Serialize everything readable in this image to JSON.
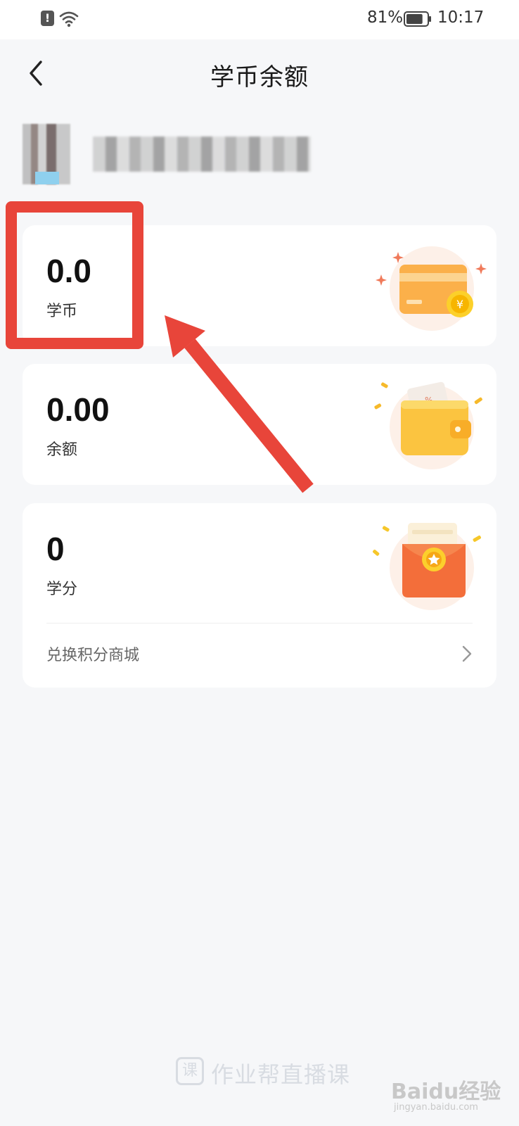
{
  "status_bar": {
    "alert_glyph": "!",
    "wifi_icon": "wifi-icon",
    "battery_percent": "81%",
    "battery_level": 0.81,
    "time": "10:17"
  },
  "header": {
    "back_icon": "chevron-left-icon",
    "title": "学币余额"
  },
  "cards": {
    "coins": {
      "value": "0.0",
      "label": "学币",
      "icon": "bank-card-coin-icon"
    },
    "balance": {
      "value": "0.00",
      "label": "余额",
      "icon": "wallet-icon"
    },
    "points": {
      "value": "0",
      "label": "学分",
      "icon": "red-envelope-icon"
    }
  },
  "mall_link": {
    "label": "兑换积分商城",
    "icon": "chevron-right-icon"
  },
  "footer": {
    "logo_glyph": "课",
    "brand": "作业帮直播课"
  },
  "watermark": {
    "main": "Baidu经验",
    "sub": "jingyan.baidu.com"
  },
  "colors": {
    "annotation_red": "#e8453a",
    "page_background": "#f6f7f9",
    "card_background": "#ffffff"
  }
}
